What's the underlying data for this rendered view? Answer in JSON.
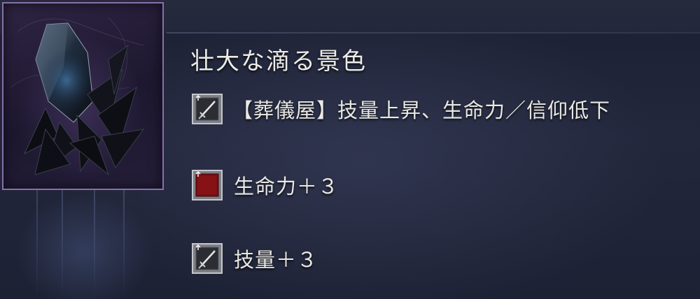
{
  "item": {
    "name": "壮大な滴る景色",
    "image_icon": "dark-crystal-shard-icon",
    "frame_color": "#8a6fa8"
  },
  "effects": [
    {
      "icon": "sword-stat-icon",
      "text": "【葬儀屋】技量上昇、生命力／信仰低下"
    },
    {
      "icon": "vitality-stat-icon",
      "text": "生命力＋３"
    },
    {
      "icon": "sword-stat-icon",
      "text": "技量＋３"
    }
  ],
  "colors": {
    "text": "#e9e8e3",
    "vitality": "#7a0f12",
    "background": "#1b1f31"
  }
}
